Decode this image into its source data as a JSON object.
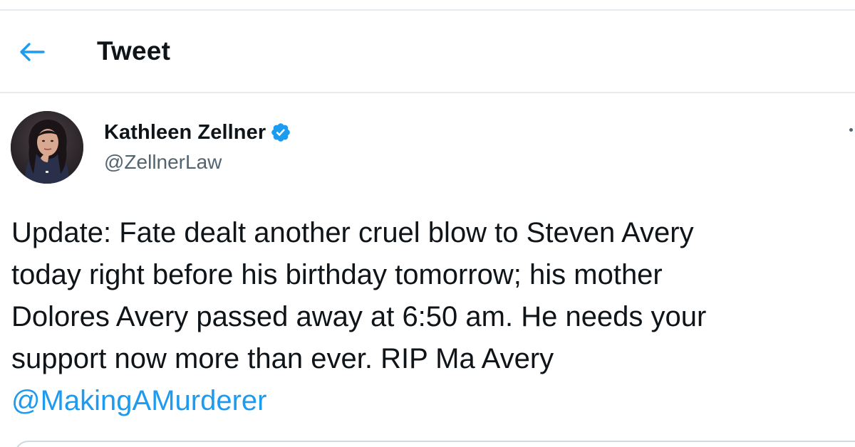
{
  "header": {
    "title": "Tweet",
    "back_icon": "arrow-left-icon"
  },
  "tweet": {
    "author": {
      "name": "Kathleen Zellner",
      "handle": "@ZellnerLaw",
      "verified": true,
      "verified_icon": "verified-badge-icon"
    },
    "text_lines": [
      "Update: Fate dealt another cruel blow to Steven Avery",
      "today right before his birthday tomorrow; his mother",
      "Dolores Avery passed away at 6:50 am. He needs your",
      "support now  more than ever. RIP Ma Avery"
    ],
    "mention": "@MakingAMurderer",
    "more_icon": "more-options-icon"
  },
  "colors": {
    "accent": "#1d9bf0",
    "text": "#0f1419",
    "secondary_text": "#536471",
    "divider": "#e6ecf0"
  }
}
